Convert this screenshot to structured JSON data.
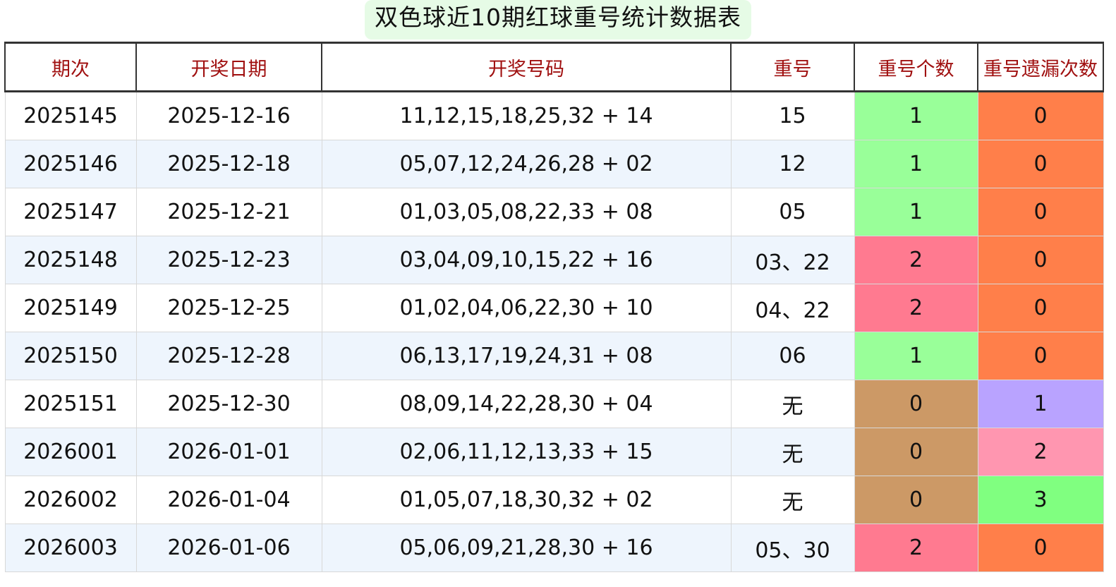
{
  "title": "双色球近10期红球重号统计数据表",
  "headers": [
    "期次",
    "开奖日期",
    "开奖号码",
    "重号",
    "重号个数",
    "重号遗漏次数"
  ],
  "count_colors": {
    "0": "#cc9966",
    "1": "#99ff99",
    "2": "#ff7a90"
  },
  "miss_colors": {
    "0": "#ff7f4a",
    "1": "#b9a3ff",
    "2": "#ff96b0",
    "3": "#80ff80"
  },
  "rows": [
    {
      "issue": "2025145",
      "date": "2025-12-16",
      "numbers": "11,12,15,18,25,32 + 14",
      "repeat": "15",
      "count": "1",
      "miss": "0"
    },
    {
      "issue": "2025146",
      "date": "2025-12-18",
      "numbers": "05,07,12,24,26,28 + 02",
      "repeat": "12",
      "count": "1",
      "miss": "0"
    },
    {
      "issue": "2025147",
      "date": "2025-12-21",
      "numbers": "01,03,05,08,22,33 + 08",
      "repeat": "05",
      "count": "1",
      "miss": "0"
    },
    {
      "issue": "2025148",
      "date": "2025-12-23",
      "numbers": "03,04,09,10,15,22 + 16",
      "repeat": "03、22",
      "count": "2",
      "miss": "0"
    },
    {
      "issue": "2025149",
      "date": "2025-12-25",
      "numbers": "01,02,04,06,22,30 + 10",
      "repeat": "04、22",
      "count": "2",
      "miss": "0"
    },
    {
      "issue": "2025150",
      "date": "2025-12-28",
      "numbers": "06,13,17,19,24,31 + 08",
      "repeat": "06",
      "count": "1",
      "miss": "0"
    },
    {
      "issue": "2025151",
      "date": "2025-12-30",
      "numbers": "08,09,14,22,28,30 + 04",
      "repeat": "无",
      "count": "0",
      "miss": "1"
    },
    {
      "issue": "2026001",
      "date": "2026-01-01",
      "numbers": "02,06,11,12,13,33 + 15",
      "repeat": "无",
      "count": "0",
      "miss": "2"
    },
    {
      "issue": "2026002",
      "date": "2026-01-04",
      "numbers": "01,05,07,18,30,32 + 02",
      "repeat": "无",
      "count": "0",
      "miss": "3"
    },
    {
      "issue": "2026003",
      "date": "2026-01-06",
      "numbers": "05,06,09,21,28,30 + 16",
      "repeat": "05、30",
      "count": "2",
      "miss": "0"
    }
  ]
}
